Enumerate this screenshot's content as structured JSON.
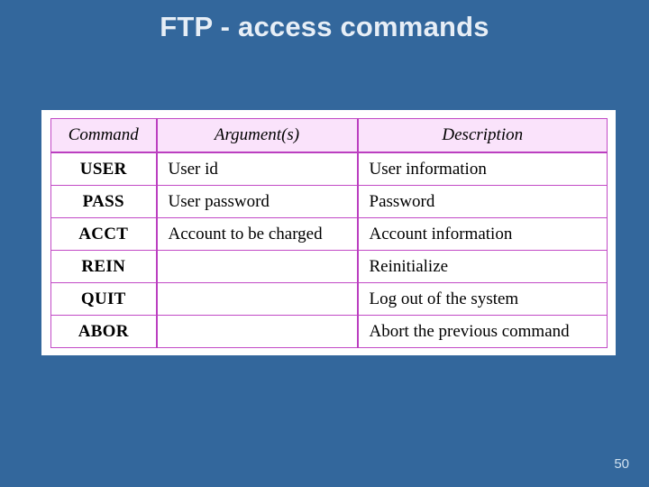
{
  "slide": {
    "title": "FTP - access commands",
    "page_number": "50",
    "background_color": "#33679c",
    "title_color": "#e7eef6",
    "card_color": "#ffffff",
    "table_border_color": "#bb3fc0",
    "header_fill_color": "#fae3fb"
  },
  "table": {
    "headers": {
      "command": "Command",
      "argument": "Argument(s)",
      "description": "Description"
    },
    "rows": [
      {
        "command": "USER",
        "argument": "User id",
        "description": "User information"
      },
      {
        "command": "PASS",
        "argument": "User password",
        "description": "Password"
      },
      {
        "command": "ACCT",
        "argument": "Account to be charged",
        "description": "Account information"
      },
      {
        "command": "REIN",
        "argument": "",
        "description": "Reinitialize"
      },
      {
        "command": "QUIT",
        "argument": "",
        "description": "Log out of the system"
      },
      {
        "command": "ABOR",
        "argument": "",
        "description": "Abort the previous command"
      }
    ]
  }
}
